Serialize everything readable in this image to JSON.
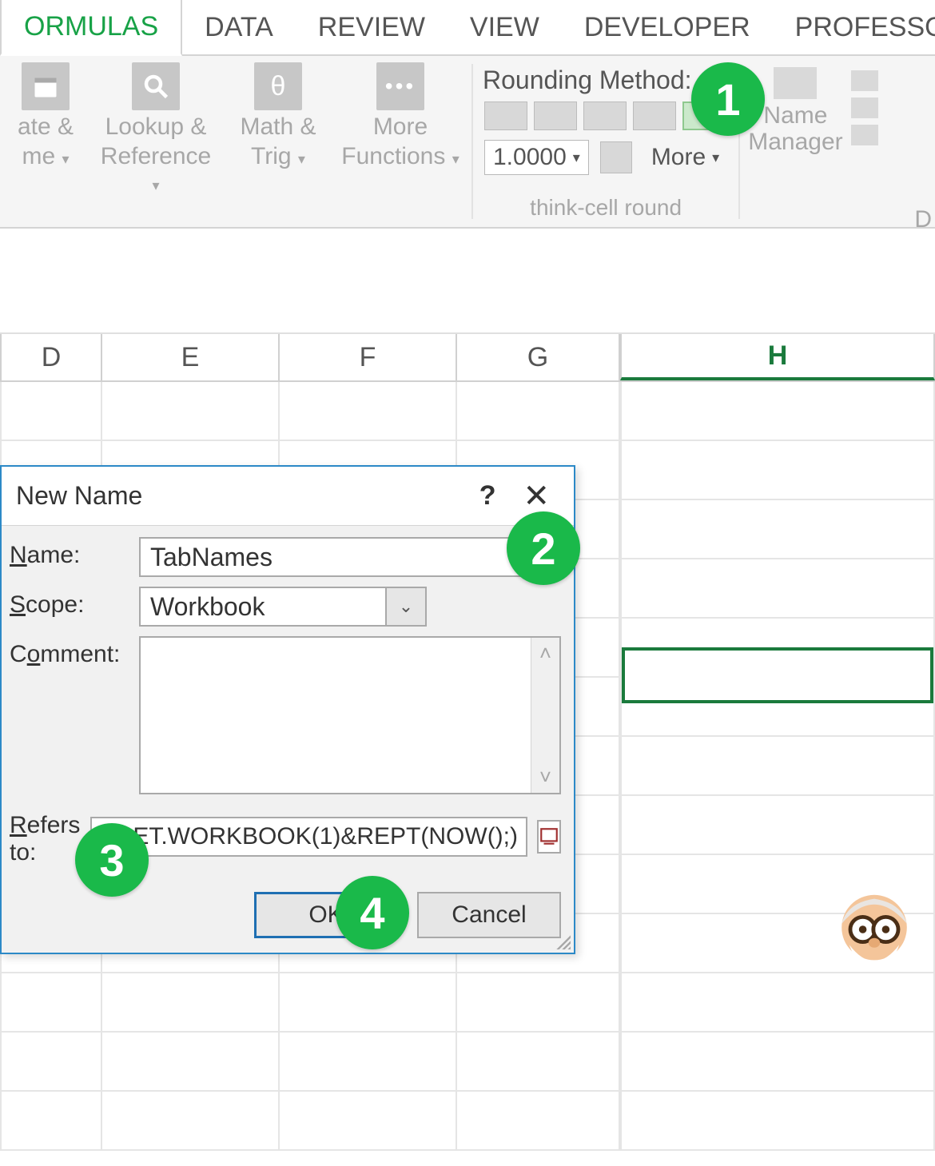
{
  "ribbon": {
    "tabs": [
      "ORMULAS",
      "DATA",
      "REVIEW",
      "VIEW",
      "DEVELOPER",
      "PROFESSO"
    ],
    "active_tab_index": 0,
    "groups": {
      "funcs": {
        "buttons": [
          {
            "label_1": "ate &",
            "label_2": "me"
          },
          {
            "label_1": "Lookup &",
            "label_2": "Reference"
          },
          {
            "label_1": "Math &",
            "label_2": "Trig"
          },
          {
            "label_1": "More",
            "label_2": "Functions"
          }
        ]
      },
      "round": {
        "heading": "Rounding Method:",
        "combo_value": "1.0000",
        "more_label": "More",
        "group_label": "think-cell round"
      },
      "names": {
        "name_manager": "Name\nManager",
        "trailing_letter": "D"
      }
    }
  },
  "columns": [
    "D",
    "E",
    "F",
    "G",
    "H"
  ],
  "dialog": {
    "title": "New Name",
    "labels": {
      "name": "Name:",
      "scope": "Scope:",
      "comment": "Comment:",
      "refers_to": "Refers to:"
    },
    "name_value": "TabNames",
    "scope_value": "Workbook",
    "comment_value": "",
    "refers_to_value": "=GET.WORKBOOK(1)&REPT(NOW();)",
    "ok": "OK",
    "cancel": "Cancel"
  },
  "badges": {
    "b1": "1",
    "b2": "2",
    "b3": "3",
    "b4": "4"
  },
  "colors": {
    "accent": "#1ab94a",
    "excel_green": "#1a7a3c",
    "dialog_border": "#2c89c7"
  }
}
